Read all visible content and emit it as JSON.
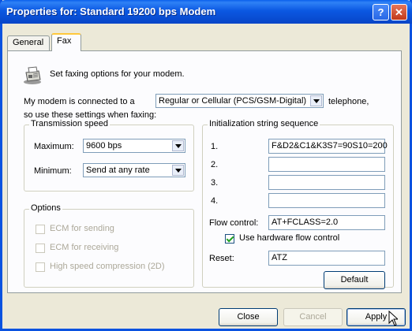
{
  "window": {
    "title": "Properties for: Standard 19200 bps Modem"
  },
  "tabs": [
    {
      "label": "General"
    },
    {
      "label": "Fax"
    }
  ],
  "intro": "Set faxing options for your modem.",
  "connected": {
    "prefix": "My modem is connected to a",
    "value": "Regular or Cellular (PCS/GSM-Digital)",
    "suffix": "telephone,",
    "line2": "so use these settings when faxing:"
  },
  "transmission": {
    "legend": "Transmission speed",
    "maximum_label": "Maximum:",
    "maximum_value": "9600 bps",
    "minimum_label": "Minimum:",
    "minimum_value": "Send at any rate"
  },
  "options": {
    "legend": "Options",
    "ecm_send": "ECM for sending",
    "ecm_receive": "ECM for receiving",
    "compression": "High speed compression (2D)"
  },
  "init": {
    "legend": "Initialization string sequence",
    "rows": [
      {
        "label": "1.",
        "value": "F&D2&C1&K3S7=90S10=200"
      },
      {
        "label": "2.",
        "value": ""
      },
      {
        "label": "3.",
        "value": ""
      },
      {
        "label": "4.",
        "value": ""
      }
    ],
    "flow_label": "Flow control:",
    "flow_value": "AT+FCLASS=2.0",
    "hw_flow_label": "Use hardware flow control",
    "reset_label": "Reset:",
    "reset_value": "ATZ",
    "default_button": "Default"
  },
  "buttons": {
    "close": "Close",
    "cancel": "Cancel",
    "apply": "Apply"
  },
  "colors": {
    "title_bar": "#0A52E0",
    "dialog_bg": "#ECE9D8",
    "panel_bg": "#FCFCFE",
    "check_green": "#21A121"
  }
}
